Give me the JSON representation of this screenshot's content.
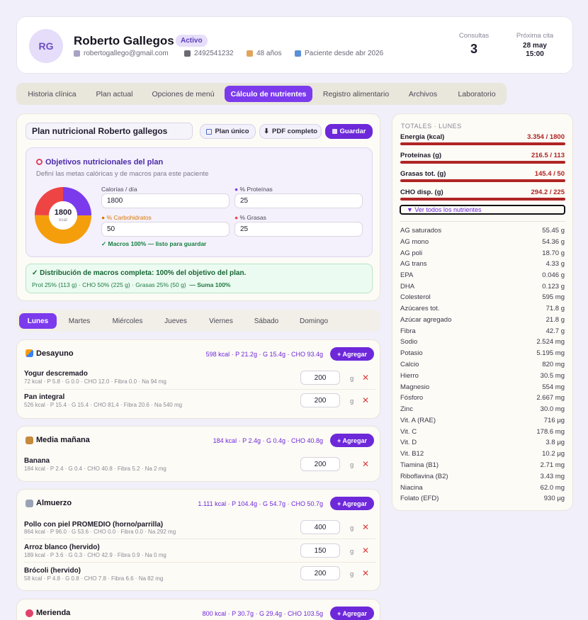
{
  "patient": {
    "initials": "RG",
    "name": "Roberto Gallegos",
    "status": "Activo",
    "email": "robertogallego@gmail.com",
    "phone": "2492541232",
    "age": "48 años",
    "since": "Paciente desde abr 2026"
  },
  "stats": {
    "consultas_label": "Consultas",
    "consultas_value": "3",
    "proxima_label": "Próxima cita",
    "proxima_date": "28 may",
    "proxima_time": "15:00"
  },
  "tabs": [
    "Historia clínica",
    "Plan actual",
    "Opciones de menú",
    "Cálculo de nutrientes",
    "Registro alimentario",
    "Archivos",
    "Laboratorio"
  ],
  "active_tab": "Cálculo de nutrientes",
  "plan": {
    "title": "Plan nutricional Roberto gallegos",
    "btn_unique": "Plan único",
    "btn_pdf": "PDF completo",
    "btn_save": "Guardar"
  },
  "objectives": {
    "title": "Objetivos nutricionales del plan",
    "subtitle": "Definí las metas calóricas y de macros para este paciente",
    "donut_value": "1800",
    "donut_unit": "kcal",
    "cal_label": "Calorías / día",
    "cal_value": "1800",
    "prot_label": "% Proteínas",
    "prot_value": "25",
    "cho_label": "% Carbohidratos",
    "cho_value": "50",
    "fat_label": "% Grasas",
    "fat_value": "25",
    "ok_text": "✓ Macros 100% — listo para guardar",
    "donut": [
      {
        "name": "Proteínas",
        "pct": 25,
        "color": "#7c3aed"
      },
      {
        "name": "Carbohidratos",
        "pct": 50,
        "color": "#f59e0b"
      },
      {
        "name": "Grasas",
        "pct": 25,
        "color": "#ef4444"
      }
    ]
  },
  "distribution": {
    "title": "✓ Distribución de macros completa: 100% del objetivo del plan.",
    "detail": "Prot 25% (113 g) · CHO 50% (225 g) · Grasas 25% (50 g)",
    "sum": "— Suma 100%"
  },
  "days": [
    "Lunes",
    "Martes",
    "Miércoles",
    "Jueves",
    "Viernes",
    "Sábado",
    "Domingo"
  ],
  "add_label": "+ Agregar",
  "unit": "g",
  "meals": [
    {
      "name": "Desayuno",
      "summary": "598 kcal · P 21.2g · G 15.4g · CHO 93.4g",
      "foods": [
        {
          "name": "Yogur descremado",
          "detail": "72 kcal · P 5.8 · G 0.0 · CHO 12.0 · Fibra 0.0 · Na 94 mg",
          "qty": "200"
        },
        {
          "name": "Pan integral",
          "detail": "526 kcal · P 15.4 · G 15.4 · CHO 81.4 · Fibra 20.6 · Na 540 mg",
          "qty": "200"
        }
      ]
    },
    {
      "name": "Media mañana",
      "summary": "184 kcal · P 2.4g · G 0.4g · CHO 40.8g",
      "foods": [
        {
          "name": "Banana",
          "detail": "184 kcal · P 2.4 · G 0.4 · CHO 40.8 · Fibra 5.2 · Na 2 mg",
          "qty": "200"
        }
      ]
    },
    {
      "name": "Almuerzo",
      "summary": "1.111 kcal · P 104.4g · G 54.7g · CHO 50.7g",
      "foods": [
        {
          "name": "Pollo con piel PROMEDIO (horno/parrilla)",
          "detail": "864 kcal · P 96.0 · G 53.6 · CHO 0.0 · Fibra 0.0 · Na 292 mg",
          "qty": "400"
        },
        {
          "name": "Arroz blanco (hervido)",
          "detail": "189 kcal · P 3.6 · G 0.3 · CHO 42.9 · Fibra 0.9 · Na 0 mg",
          "qty": "150"
        },
        {
          "name": "Brócoli (hervido)",
          "detail": "58 kcal · P 4.8 · G 0.8 · CHO 7.8 · Fibra 6.6 · Na 82 mg",
          "qty": "200"
        }
      ]
    },
    {
      "name": "Merienda",
      "summary": "800 kcal · P 30.7g · G 29.4g · CHO 103.5g",
      "foods": []
    }
  ],
  "totals": {
    "header": "TOTALES · LUNES",
    "view_all": "▼  Ver todos los nutrientes",
    "main": [
      {
        "label": "Energía (kcal)",
        "value": "3.354 / 1800",
        "ratio": 1
      },
      {
        "label": "Proteínas (g)",
        "value": "216.5 / 113",
        "ratio": 1
      },
      {
        "label": "Grasas tot. (g)",
        "value": "145.4 / 50",
        "ratio": 1
      },
      {
        "label": "CHO disp. (g)",
        "value": "294.2 / 225",
        "ratio": 1
      }
    ],
    "nutrients": [
      {
        "label": "AG saturados",
        "value": "55.45 g"
      },
      {
        "label": "AG mono",
        "value": "54.36 g"
      },
      {
        "label": "AG poli",
        "value": "18.70 g"
      },
      {
        "label": "AG trans",
        "value": "4.33 g"
      },
      {
        "label": "EPA",
        "value": "0.046 g"
      },
      {
        "label": "DHA",
        "value": "0.123 g"
      },
      {
        "label": "Colesterol",
        "value": "595 mg"
      },
      {
        "label": "Azúcares tot.",
        "value": "71.8 g"
      },
      {
        "label": "Azúcar agregado",
        "value": "21.8 g"
      },
      {
        "label": "Fibra",
        "value": "42.7 g"
      },
      {
        "label": "Sodio",
        "value": "2.524 mg"
      },
      {
        "label": "Potasio",
        "value": "5.195 mg"
      },
      {
        "label": "Calcio",
        "value": "820 mg"
      },
      {
        "label": "Hierro",
        "value": "30.5 mg"
      },
      {
        "label": "Magnesio",
        "value": "554 mg"
      },
      {
        "label": "Fósforo",
        "value": "2.667 mg"
      },
      {
        "label": "Zinc",
        "value": "30.0 mg"
      },
      {
        "label": "Vit. A (RAE)",
        "value": "716 µg"
      },
      {
        "label": "Vit. C",
        "value": "178.6 mg"
      },
      {
        "label": "Vit. D",
        "value": "3.8 µg"
      },
      {
        "label": "Vit. B12",
        "value": "10.2 µg"
      },
      {
        "label": "Tiamina (B1)",
        "value": "2.71 mg"
      },
      {
        "label": "Riboflavina (B2)",
        "value": "3.43 mg"
      },
      {
        "label": "Niacina",
        "value": "62.0 mg"
      },
      {
        "label": "Folato (EFD)",
        "value": "930 µg"
      }
    ]
  }
}
